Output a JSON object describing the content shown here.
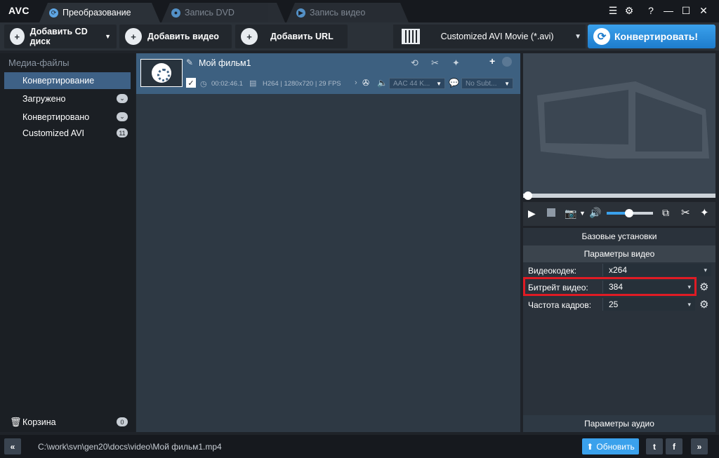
{
  "app": {
    "logo": "AVC"
  },
  "tabs": [
    {
      "label": "Преобразование",
      "icon": "refresh-icon"
    },
    {
      "label": "Запись DVD",
      "icon": "disc-icon"
    },
    {
      "label": "Запись видео",
      "icon": "play-circle-icon"
    }
  ],
  "toolbar": {
    "add_cd": "Добавить CD диск",
    "add_video": "Добавить видео",
    "add_url": "Добавить URL",
    "profile": "Customized AVI Movie (*.avi)",
    "convert": "Конвертировать!"
  },
  "sidebar": {
    "header": "Медиа-файлы",
    "items": [
      {
        "label": "Конвертирование",
        "badge": ""
      },
      {
        "label": "Загружено",
        "badge": "⌄"
      },
      {
        "label": "Конвертировано",
        "badge": "⌄"
      },
      {
        "label": "Customized AVI",
        "badge": "11"
      }
    ],
    "trash": {
      "label": "Корзина",
      "badge": "0"
    }
  },
  "file": {
    "title": "Мой фильм1",
    "duration": "00:02:46.1",
    "video_info": "H264 | 1280x720 | 29 FPS",
    "audio": "AAC 44 K...",
    "subtitle": "No Subt..."
  },
  "preview": {
    "seek": 0.0,
    "volume": 0.6
  },
  "settings": {
    "basic": "Базовые установки",
    "video_params": "Параметры видео",
    "rows": [
      {
        "label": "Видеокодек:",
        "value": "x264"
      },
      {
        "label": "Битрейт видео:",
        "value": "384"
      },
      {
        "label": "Частота кадров:",
        "value": "25"
      }
    ],
    "audio_params": "Параметры аудио"
  },
  "status": {
    "path": "C:\\work\\svn\\gen20\\docs\\video\\Мой фильм1.mp4",
    "update": "Обновить"
  },
  "colors": {
    "accent": "#3aa1ec",
    "selection": "#3e6186",
    "highlight": "#e01b24"
  }
}
